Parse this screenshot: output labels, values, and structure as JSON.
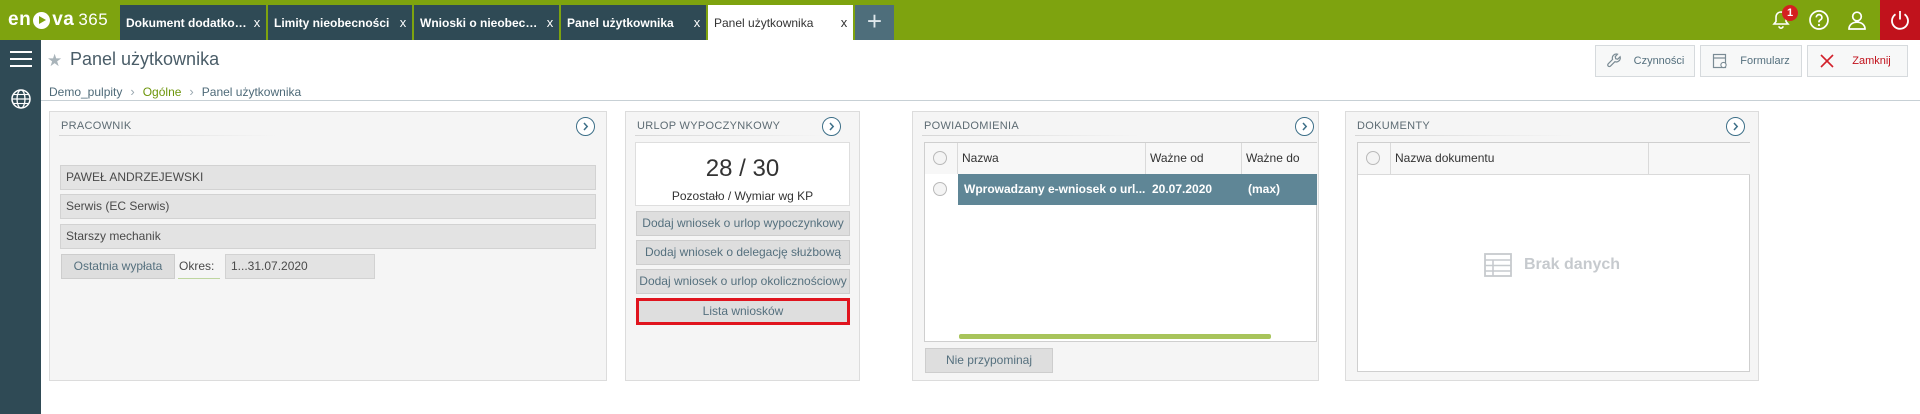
{
  "app": {
    "logo_prefix": "en",
    "logo_suffix": "va",
    "logo_num": "365"
  },
  "tabs": [
    {
      "label": "Dokument dodatkow...",
      "close": "x"
    },
    {
      "label": "Limity nieobecności",
      "close": "x"
    },
    {
      "label": "Wnioski o nieobecności",
      "close": "x"
    },
    {
      "label": "Panel użytkownika",
      "close": "x"
    },
    {
      "label": "Panel użytkownika",
      "close": "x"
    }
  ],
  "tab_add": "+",
  "topbar": {
    "notifications_count": "1",
    "icons": [
      "bell-icon",
      "help-icon",
      "user-icon",
      "power-icon"
    ]
  },
  "header": {
    "title": "Panel użytkownika",
    "breadcrumb": [
      "Demo_pulpity",
      "Ogólne",
      "Panel użytkownika"
    ],
    "actions": {
      "czynnosci": "Czynności",
      "formularz": "Formularz",
      "zamknij": "Zamknij"
    }
  },
  "pracownik": {
    "title": "PRACOWNIK",
    "name": "PAWEŁ ANDRZEJEWSKI",
    "department": "Serwis (EC Serwis)",
    "position": "Starszy mechanik",
    "last_pay_button": "Ostatnia wypłata",
    "period_label": "Okres:",
    "period_value": "1...31.07.2020"
  },
  "urlop": {
    "title": "URLOP WYPOCZYNKOWY",
    "summary": "28 / 30",
    "summary_label": "Pozostało / Wymiar wg KP",
    "buttons": [
      "Dodaj wniosek o urlop wypoczynkowy",
      "Dodaj wniosek o delegację służbową",
      "Dodaj wniosek o urlop okolicznościowy",
      "Lista wniosków"
    ]
  },
  "powiadomienia": {
    "title": "POWIADOMIENIA",
    "columns": [
      "Nazwa",
      "Ważne od",
      "Ważne do"
    ],
    "rows": [
      {
        "name": "Wprowadzany e-wniosek o url...",
        "from": "20.07.2020",
        "to": "(max)"
      }
    ],
    "dismiss_button": "Nie przypominaj"
  },
  "dokumenty": {
    "title": "DOKUMENTY",
    "columns": [
      "Nazwa dokumentu"
    ],
    "empty_text": "Brak danych"
  },
  "colors": {
    "topbar": "#7ea30f",
    "dark": "#2f4a55",
    "highlight": "#e0141e",
    "row_selected": "#5f8696"
  }
}
